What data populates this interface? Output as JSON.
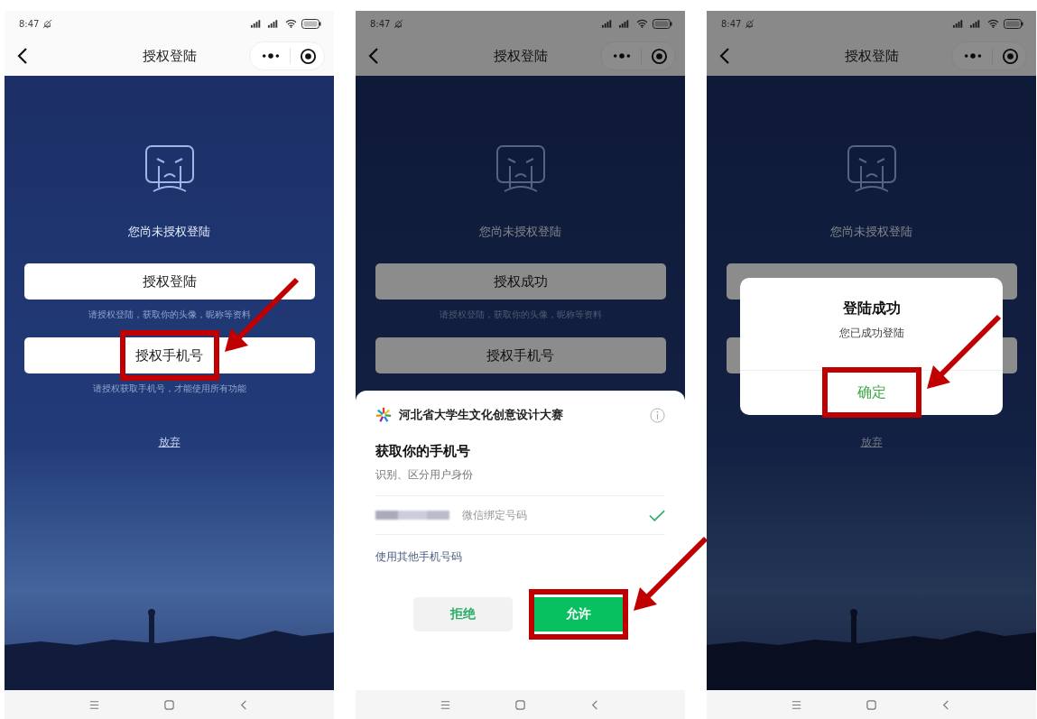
{
  "screens": [
    {
      "status_bar": {
        "time": "8:47"
      },
      "title": "授权登陆",
      "prompt": "您尚未授权登陆",
      "buttons": [
        {
          "label": "授权登陆",
          "hint": "请授权登陆，获取你的头像，昵称等资料"
        },
        {
          "label": "授权手机号",
          "highlighted": true,
          "hint": "请授权获取手机号，才能使用所有功能"
        }
      ],
      "cancel_link": "放弃"
    },
    {
      "status_bar": {
        "time": "8:47"
      },
      "title": "授权登陆",
      "dimmed": true,
      "prompt": "您尚未授权登陆",
      "buttons": [
        {
          "label": "授权成功",
          "hint": "请授权登陆，获取你的头像，昵称等资料"
        },
        {
          "label": "授权手机号"
        }
      ],
      "overlay": {
        "kind": "sheet",
        "app_name": "河北省大学生文化创意设计大赛",
        "heading": "获取你的手机号",
        "subheading": "识别、区分用户身份",
        "phone_option": {
          "label": "微信绑定号码",
          "selected": true
        },
        "other_option": "使用其他手机号码",
        "actions": [
          {
            "label": "拒绝",
            "kind": "secondary"
          },
          {
            "label": "允许",
            "kind": "primary",
            "highlighted": true
          }
        ]
      }
    },
    {
      "status_bar": {
        "time": "8:47"
      },
      "title": "授权登陆",
      "dimmed": true,
      "prompt": "您尚未授权登陆",
      "buttons": [
        {
          "covered": true
        },
        {
          "covered": true
        }
      ],
      "cancel_link": "放弃",
      "overlay": {
        "kind": "dialog",
        "title": "登陆成功",
        "message": "您已成功登陆",
        "actions": [
          {
            "label": "确定",
            "kind": "primary",
            "highlighted": true
          }
        ]
      }
    }
  ]
}
